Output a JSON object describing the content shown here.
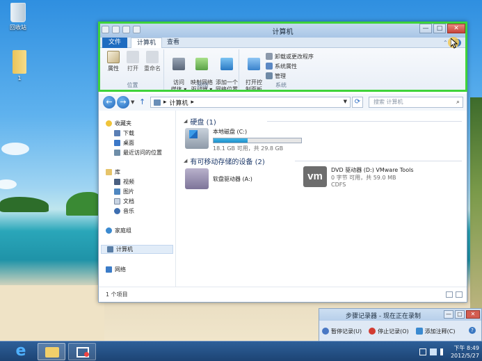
{
  "desktop": {
    "icons": [
      {
        "label": "回收站"
      },
      {
        "label": "1"
      }
    ]
  },
  "explorer": {
    "title": "计算机",
    "ribbon_tabs": {
      "file": "文件",
      "computer": "计算机",
      "view": "查看"
    },
    "ribbon": {
      "location": {
        "label": "位置",
        "buttons": [
          "属性",
          "打开",
          "重命名"
        ]
      },
      "network": {
        "label": "网络",
        "buttons": [
          "访问\n媒体 ▾",
          "映射网络\n驱动器 ▾",
          "添加一个\n网络位置"
        ]
      },
      "system": {
        "label": "系统",
        "open_control_panel": "打开控\n制面板",
        "small_items": [
          "卸载或更改程序",
          "系统属性",
          "管理"
        ]
      }
    },
    "address": {
      "path": "计算机",
      "separator": "▸"
    },
    "search": {
      "placeholder": "搜索 计算机"
    },
    "nav": {
      "favorites": "收藏夹",
      "favorite_items": [
        "下载",
        "桌面",
        "最近访问的位置"
      ],
      "libraries": "库",
      "library_items": [
        "视频",
        "图片",
        "文档",
        "音乐"
      ],
      "homegroup": "家庭组",
      "computer": "计算机",
      "network": "网络"
    },
    "groups": {
      "hdd": "硬盘 (1)",
      "removable": "有可移动存储的设备 (2)"
    },
    "drives": {
      "c": {
        "name": "本地磁盘 (C:)",
        "space": "18.1 GB 可用，共 29.8 GB",
        "used_fraction": 0.39
      },
      "a": {
        "name": "软盘驱动器 (A:)"
      },
      "d": {
        "name": "DVD 驱动器 (D:) VMware Tools",
        "space": "0 字节 可用，共 59.0 MB",
        "fs": "CDFS",
        "logo": "vm"
      }
    },
    "status": "1 个项目",
    "window_buttons": {
      "min": "—",
      "max": "□",
      "close": "✕"
    }
  },
  "steps_recorder": {
    "title": "步骤记录器 - 现在正在录制",
    "pause": "暂停记录(U)",
    "stop": "停止记录(O)",
    "comment": "添加注释(C)"
  },
  "taskbar": {
    "time": "下午 8:49",
    "date": "2012/5/27"
  },
  "colors": {
    "highlight_frame": "#3fd33a",
    "file_tab": "#1f6cc0",
    "progress": "#1f8fca"
  }
}
